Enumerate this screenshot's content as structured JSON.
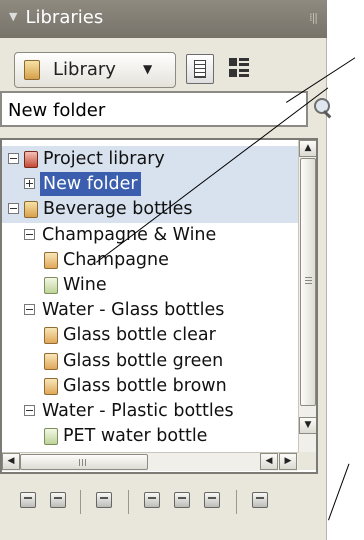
{
  "panel": {
    "title": "Libraries",
    "collapse_icon": "triangle-down-icon",
    "grip_icon": "panel-grip-icon"
  },
  "toolbar": {
    "library_dropdown": "Library",
    "dropdown_arrow": "▼",
    "list_view_icon": "list-view-icon",
    "tree_view_icon": "tree-view-icon"
  },
  "search": {
    "value": "New folder",
    "search_icon": "magnifier-icon"
  },
  "tree": {
    "rows": [
      {
        "label": "Project library",
        "level": 0,
        "expander": "minus",
        "icon": "red"
      },
      {
        "label": "New folder",
        "level": 1,
        "expander": "plus",
        "selected": true
      },
      {
        "label": "Beverage bottles",
        "level": 0,
        "expander": "minus",
        "icon": "prod"
      },
      {
        "label": "Champagne & Wine",
        "level": 1,
        "expander": "minus"
      },
      {
        "label": "Champagne",
        "level": 2,
        "icon": "orange"
      },
      {
        "label": "Wine",
        "level": 2,
        "icon": "green"
      },
      {
        "label": "Water - Glass bottles",
        "level": 1,
        "expander": "minus"
      },
      {
        "label": "Glass bottle clear",
        "level": 2,
        "icon": "orange"
      },
      {
        "label": "Glass bottle green",
        "level": 2,
        "icon": "orange"
      },
      {
        "label": "Glass bottle brown",
        "level": 2,
        "icon": "orange"
      },
      {
        "label": "Water - Plastic bottles",
        "level": 1,
        "expander": "minus"
      },
      {
        "label": "PET water bottle",
        "level": 2,
        "icon": "green"
      }
    ]
  },
  "colors": {
    "panel_bg": "#e9e6dc",
    "selection": "#3b5fae",
    "row_highlight": "#d8e2ef"
  },
  "bottom_toolbar": {
    "icons": [
      "import-icon",
      "export-icon",
      "library-properties-icon",
      "copy-icon",
      "cut-icon",
      "paste-icon",
      "delete-icon"
    ]
  }
}
